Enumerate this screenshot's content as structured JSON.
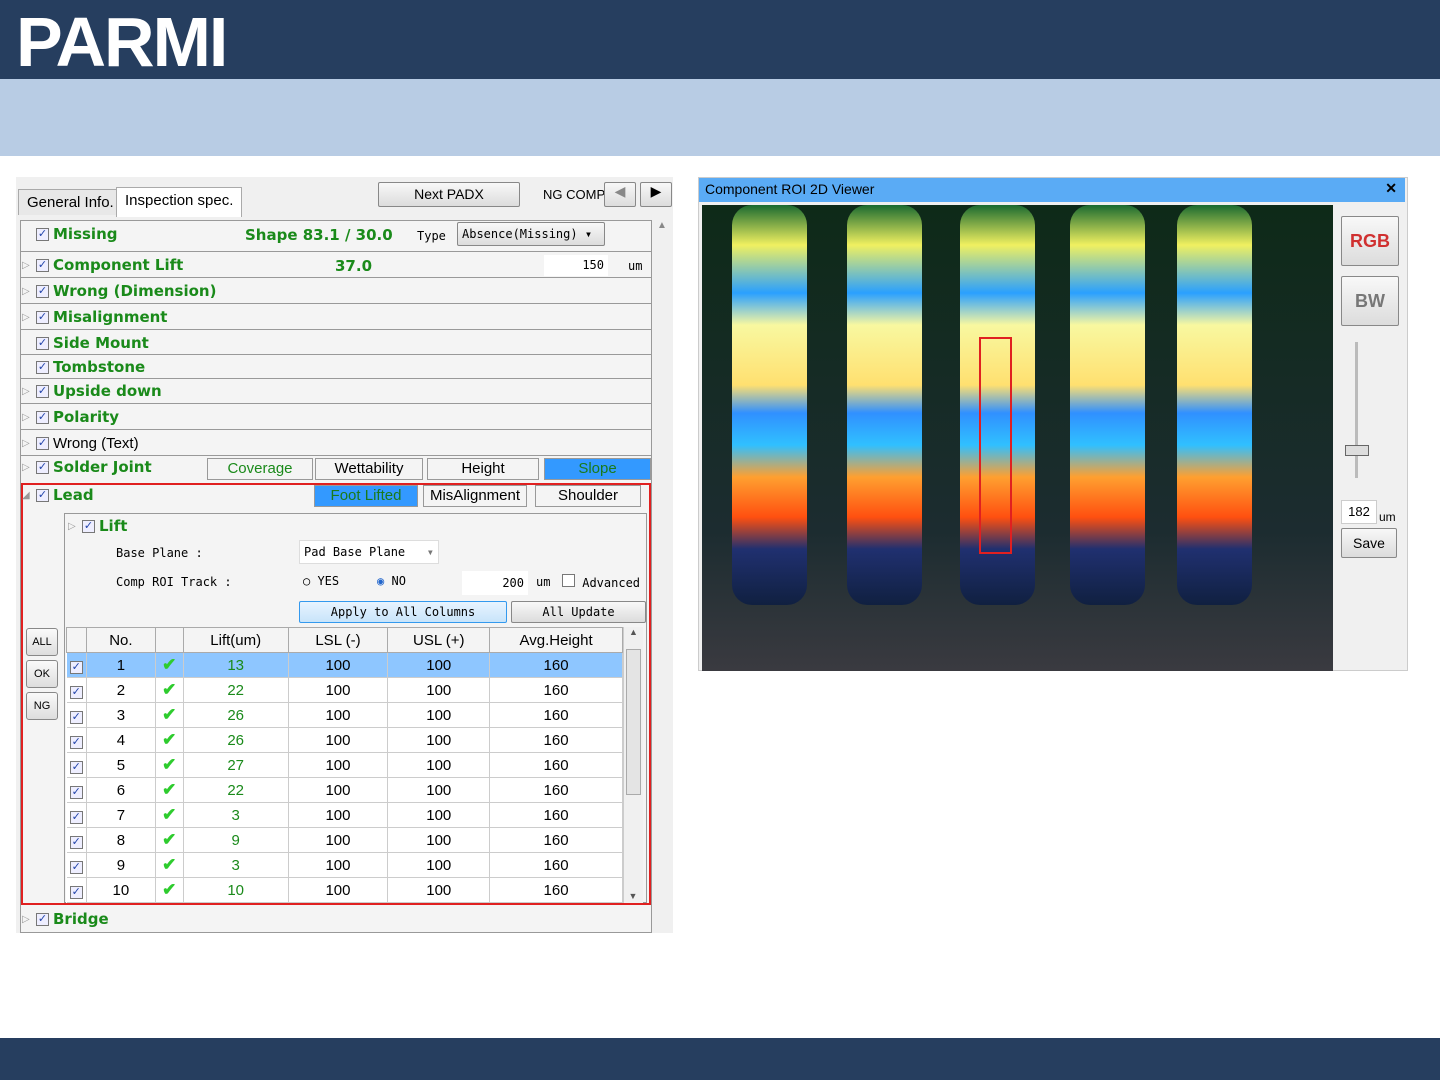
{
  "brand": {
    "logo": "PARMI"
  },
  "panel": {
    "tabs": [
      "General Info.",
      "Inspection spec."
    ],
    "next_padx": "Next PADX",
    "ng_comp": "NG COMP",
    "missing": {
      "label": "Missing",
      "shape": "Shape 83.1 / 30.0",
      "type_label": "Type",
      "type_value": "Absence(Missing)"
    },
    "component_lift": {
      "label": "Component  Lift",
      "value": "37.0",
      "input": "150",
      "unit": "um"
    },
    "items": [
      "Wrong (Dimension)",
      "Misalignment",
      "Side Mount",
      "Tombstone",
      "Upside down",
      "Polarity",
      "Wrong (Text)"
    ],
    "solder_joint": {
      "label": "Solder Joint",
      "tabs": [
        "Coverage",
        "Wettability",
        "Height",
        "Slope"
      ],
      "selected": "Slope"
    },
    "lead": {
      "label": "Lead",
      "tabs": [
        "Foot Lifted",
        "MisAlignment",
        "Shoulder"
      ],
      "selected": "Foot Lifted",
      "lift": {
        "label": "Lift",
        "base_plane_label": "Base Plane :",
        "base_plane_value": "Pad Base Plane",
        "comp_roi_label": "Comp ROI Track :",
        "yes": "YES",
        "no": "NO",
        "selected": "NO",
        "value": "200",
        "unit": "um",
        "advanced": "Advanced",
        "apply": "Apply to All Columns",
        "all_update": "All Update"
      },
      "side_buttons": [
        "ALL",
        "OK",
        "NG"
      ],
      "table": {
        "headers": [
          "No.",
          "Lift(um)",
          "LSL (-)",
          "USL (+)",
          "Avg.Height"
        ],
        "rows": [
          [
            "1",
            "13",
            "100",
            "100",
            "160"
          ],
          [
            "2",
            "22",
            "100",
            "100",
            "160"
          ],
          [
            "3",
            "26",
            "100",
            "100",
            "160"
          ],
          [
            "4",
            "26",
            "100",
            "100",
            "160"
          ],
          [
            "5",
            "27",
            "100",
            "100",
            "160"
          ],
          [
            "6",
            "22",
            "100",
            "100",
            "160"
          ],
          [
            "7",
            "3",
            "100",
            "100",
            "160"
          ],
          [
            "8",
            "9",
            "100",
            "100",
            "160"
          ],
          [
            "9",
            "3",
            "100",
            "100",
            "160"
          ],
          [
            "10",
            "10",
            "100",
            "100",
            "160"
          ]
        ],
        "selected_row": 0
      }
    },
    "bridge": {
      "label": "Bridge"
    }
  },
  "viewer": {
    "title": "Component ROI 2D Viewer",
    "close": "✕",
    "rgb": "RGB",
    "bw": "BW",
    "value": "182",
    "unit": "um",
    "save": "Save"
  },
  "colors": {
    "header": "#263E5F",
    "band": "#B8CCE4",
    "accent": "#3399ff",
    "green_text": "#1a8a1a"
  }
}
